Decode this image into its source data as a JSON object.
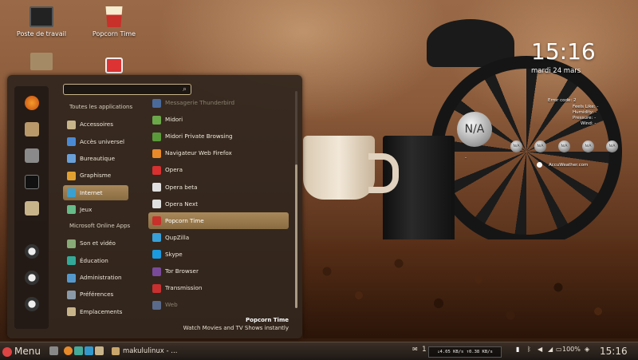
{
  "desktop": {
    "icons": [
      {
        "label": "Poste de travail",
        "icon": "computer-icon"
      },
      {
        "label": "Popcorn Time",
        "icon": "popcorn-icon"
      }
    ]
  },
  "menu": {
    "search": {
      "placeholder": "",
      "value": "",
      "icon": "search-icon"
    },
    "favorites": [
      {
        "icon": "firefox-icon"
      },
      {
        "icon": "package-icon"
      },
      {
        "icon": "control-center-icon"
      },
      {
        "icon": "terminal-icon"
      },
      {
        "icon": "folder-icon"
      },
      {
        "icon": "lock-screen-icon"
      },
      {
        "icon": "logout-icon"
      },
      {
        "icon": "shutdown-icon"
      }
    ],
    "categories": [
      {
        "label": "Toutes les applications",
        "icon": "",
        "header": true
      },
      {
        "label": "Accessoires",
        "icon": "accessories-icon"
      },
      {
        "label": "Accès universel",
        "icon": "accessibility-icon"
      },
      {
        "label": "Bureautique",
        "icon": "office-icon"
      },
      {
        "label": "Graphisme",
        "icon": "graphics-icon"
      },
      {
        "label": "Internet",
        "icon": "internet-icon",
        "selected": true
      },
      {
        "label": "Jeux",
        "icon": "games-icon"
      },
      {
        "label": "Microsoft Online Apps",
        "icon": "",
        "header": true
      },
      {
        "label": "Son et vidéo",
        "icon": "multimedia-icon"
      },
      {
        "label": "Éducation",
        "icon": "education-icon"
      },
      {
        "label": "Administration",
        "icon": "administration-icon"
      },
      {
        "label": "Préférences",
        "icon": "preferences-icon"
      },
      {
        "label": "Emplacements",
        "icon": "places-icon"
      }
    ],
    "apps": [
      {
        "label": "Messagerie Thunderbird",
        "icon": "thunderbird-icon",
        "dim": true
      },
      {
        "label": "Midori",
        "icon": "midori-icon"
      },
      {
        "label": "Midori Private Browsing",
        "icon": "midori-private-icon"
      },
      {
        "label": "Navigateur Web Firefox",
        "icon": "firefox-icon"
      },
      {
        "label": "Opera",
        "icon": "opera-icon"
      },
      {
        "label": "Opera beta",
        "icon": "opera-beta-icon"
      },
      {
        "label": "Opera Next",
        "icon": "opera-next-icon"
      },
      {
        "label": "Popcorn Time",
        "icon": "popcorn-icon",
        "selected": true
      },
      {
        "label": "QupZilla",
        "icon": "qupzilla-icon"
      },
      {
        "label": "Skype",
        "icon": "skype-icon"
      },
      {
        "label": "Tor Browser",
        "icon": "tor-icon"
      },
      {
        "label": "Transmission",
        "icon": "transmission-icon"
      },
      {
        "label": "Web",
        "icon": "web-icon",
        "dim": true
      }
    ],
    "description": {
      "title": "Popcorn Time",
      "text": "Watch Movies and TV Shows instantly"
    }
  },
  "widgets": {
    "clock": "15:16",
    "date": "mardi 24 mars",
    "weather": {
      "error": "Error code: 2",
      "labels": [
        "Feels Like: -",
        "Humidity: -",
        "Pressure: -",
        "Wind: -"
      ],
      "current": "N/A",
      "forecast": [
        "N/A",
        "N/A",
        "N/A",
        "N/A",
        "N/A"
      ],
      "provider": "AccuWeather.com",
      "dash": "-"
    }
  },
  "taskbar": {
    "menu_label": "Menu",
    "window_label": "makululinux - ...",
    "notifications_count": "1",
    "network": "↓4.05 KB/s ↑0.38 KB/s",
    "battery": "100%",
    "clock": "15:16"
  }
}
